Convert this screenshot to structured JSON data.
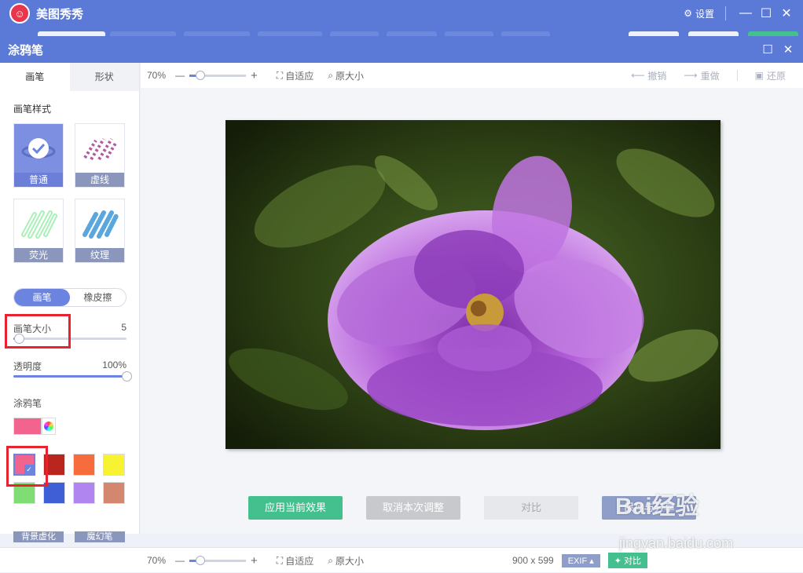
{
  "app": {
    "title": "美图秀秀",
    "settings_label": "设置"
  },
  "dialog": {
    "title": "涂鸦笔"
  },
  "left_panel": {
    "tabs": [
      "画笔",
      "形状"
    ],
    "brush_style_label": "画笔样式",
    "brushes": [
      {
        "label": "普通",
        "selected": true
      },
      {
        "label": "虚线",
        "selected": false
      },
      {
        "label": "荧光",
        "selected": false
      },
      {
        "label": "纹理",
        "selected": false
      }
    ],
    "mode": {
      "brush": "画笔",
      "eraser": "橡皮擦"
    },
    "size": {
      "label": "画笔大小",
      "value": "5",
      "fraction": 0.05
    },
    "opacity": {
      "label": "透明度",
      "value": "100%",
      "fraction": 1.0
    },
    "color_label": "涂鸦笔",
    "current_color": "#f2638e",
    "swatches": [
      "#f2638e",
      "#b9261e",
      "#f76c3c",
      "#f8f332",
      "#7fdd74",
      "#3f5fd6",
      "#b085f0",
      "#d4876f"
    ],
    "selected_swatch": 0,
    "bottom_tools": [
      "背景虚化",
      "魔幻笔"
    ]
  },
  "toolbar": {
    "zoom": "70%",
    "zoom_fraction": 0.2,
    "fit": "自适应",
    "original": "原大小",
    "undo": "撤销",
    "redo": "重做",
    "restore": "还原"
  },
  "actions": {
    "apply": "应用当前效果",
    "cancel": "取消本次调整",
    "compare": "对比",
    "save": "保存与分享"
  },
  "status": {
    "zoom": "70%",
    "fit": "自适应",
    "original": "原大小",
    "dimensions": "900 x 599",
    "exif": "EXIF",
    "compare": "对比"
  },
  "watermark": {
    "brand": "Bai经验",
    "url": "jingyan.baidu.com"
  }
}
